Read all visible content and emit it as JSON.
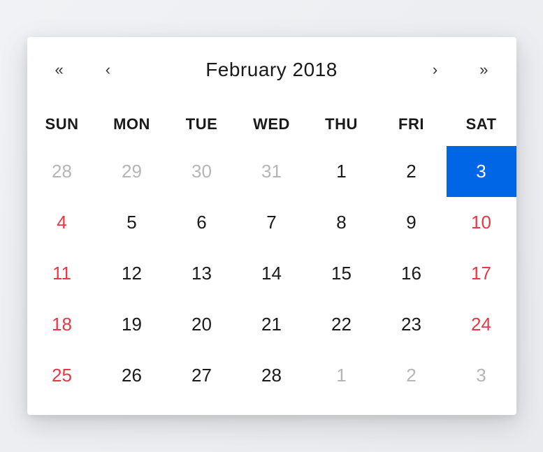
{
  "header": {
    "prev_year_label": "«",
    "prev_month_label": "‹",
    "title": "February 2018",
    "next_month_label": "›",
    "next_year_label": "»"
  },
  "weekdays": [
    "SUN",
    "MON",
    "TUE",
    "WED",
    "THU",
    "FRI",
    "SAT"
  ],
  "colors": {
    "selected_bg": "#0066e6",
    "weekend_text": "#e63946",
    "other_month_text": "#b5b5b5"
  },
  "days": [
    {
      "label": "28",
      "other_month": true,
      "weekend": false,
      "selected": false
    },
    {
      "label": "29",
      "other_month": true,
      "weekend": false,
      "selected": false
    },
    {
      "label": "30",
      "other_month": true,
      "weekend": false,
      "selected": false
    },
    {
      "label": "31",
      "other_month": true,
      "weekend": false,
      "selected": false
    },
    {
      "label": "1",
      "other_month": false,
      "weekend": false,
      "selected": false
    },
    {
      "label": "2",
      "other_month": false,
      "weekend": false,
      "selected": false
    },
    {
      "label": "3",
      "other_month": false,
      "weekend": false,
      "selected": true
    },
    {
      "label": "4",
      "other_month": false,
      "weekend": true,
      "selected": false
    },
    {
      "label": "5",
      "other_month": false,
      "weekend": false,
      "selected": false
    },
    {
      "label": "6",
      "other_month": false,
      "weekend": false,
      "selected": false
    },
    {
      "label": "7",
      "other_month": false,
      "weekend": false,
      "selected": false
    },
    {
      "label": "8",
      "other_month": false,
      "weekend": false,
      "selected": false
    },
    {
      "label": "9",
      "other_month": false,
      "weekend": false,
      "selected": false
    },
    {
      "label": "10",
      "other_month": false,
      "weekend": true,
      "selected": false
    },
    {
      "label": "11",
      "other_month": false,
      "weekend": true,
      "selected": false
    },
    {
      "label": "12",
      "other_month": false,
      "weekend": false,
      "selected": false
    },
    {
      "label": "13",
      "other_month": false,
      "weekend": false,
      "selected": false
    },
    {
      "label": "14",
      "other_month": false,
      "weekend": false,
      "selected": false
    },
    {
      "label": "15",
      "other_month": false,
      "weekend": false,
      "selected": false
    },
    {
      "label": "16",
      "other_month": false,
      "weekend": false,
      "selected": false
    },
    {
      "label": "17",
      "other_month": false,
      "weekend": true,
      "selected": false
    },
    {
      "label": "18",
      "other_month": false,
      "weekend": true,
      "selected": false
    },
    {
      "label": "19",
      "other_month": false,
      "weekend": false,
      "selected": false
    },
    {
      "label": "20",
      "other_month": false,
      "weekend": false,
      "selected": false
    },
    {
      "label": "21",
      "other_month": false,
      "weekend": false,
      "selected": false
    },
    {
      "label": "22",
      "other_month": false,
      "weekend": false,
      "selected": false
    },
    {
      "label": "23",
      "other_month": false,
      "weekend": false,
      "selected": false
    },
    {
      "label": "24",
      "other_month": false,
      "weekend": true,
      "selected": false
    },
    {
      "label": "25",
      "other_month": false,
      "weekend": true,
      "selected": false
    },
    {
      "label": "26",
      "other_month": false,
      "weekend": false,
      "selected": false
    },
    {
      "label": "27",
      "other_month": false,
      "weekend": false,
      "selected": false
    },
    {
      "label": "28",
      "other_month": false,
      "weekend": false,
      "selected": false
    },
    {
      "label": "1",
      "other_month": true,
      "weekend": false,
      "selected": false
    },
    {
      "label": "2",
      "other_month": true,
      "weekend": false,
      "selected": false
    },
    {
      "label": "3",
      "other_month": true,
      "weekend": false,
      "selected": false
    }
  ]
}
